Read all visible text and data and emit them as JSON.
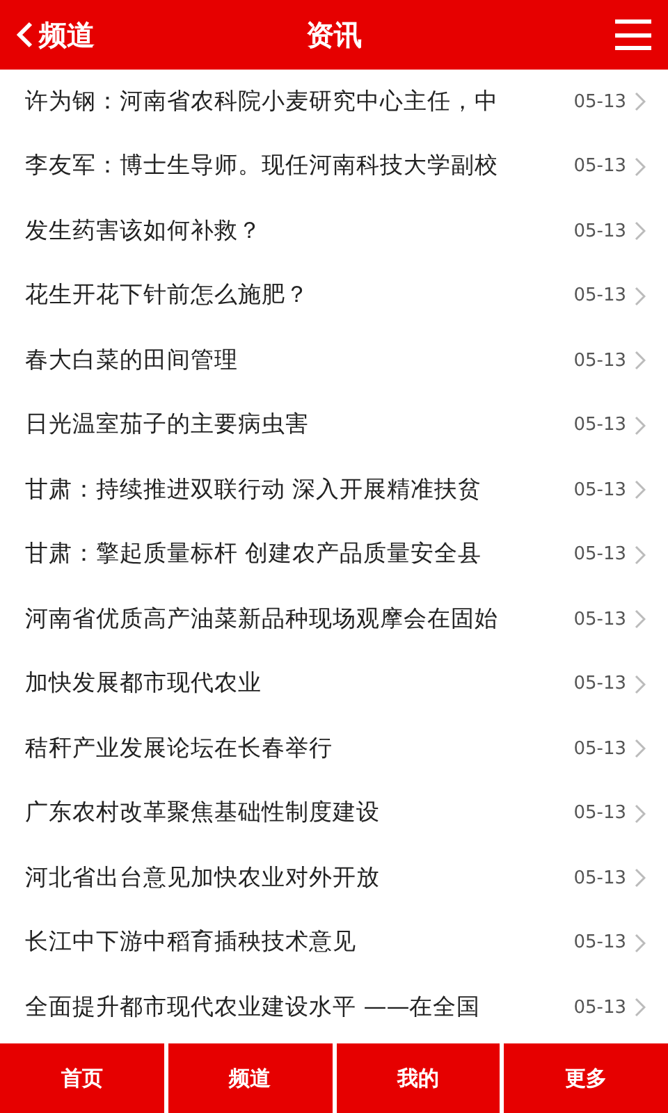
{
  "header": {
    "back_label": "频道",
    "title": "资讯"
  },
  "articles": [
    {
      "title": "许为钢：河南省农科院小麦研究中心主任，中",
      "date": "05-13"
    },
    {
      "title": "李友军：博士生导师。现任河南科技大学副校",
      "date": "05-13"
    },
    {
      "title": "发生药害该如何补救？",
      "date": "05-13"
    },
    {
      "title": "花生开花下针前怎么施肥？",
      "date": "05-13"
    },
    {
      "title": "春大白菜的田间管理",
      "date": "05-13"
    },
    {
      "title": "日光温室茄子的主要病虫害",
      "date": "05-13"
    },
    {
      "title": "甘肃：持续推进双联行动 深入开展精准扶贫",
      "date": "05-13"
    },
    {
      "title": "甘肃：擎起质量标杆 创建农产品质量安全县",
      "date": "05-13"
    },
    {
      "title": "河南省优质高产油菜新品种现场观摩会在固始",
      "date": "05-13"
    },
    {
      "title": "加快发展都市现代农业",
      "date": "05-13"
    },
    {
      "title": "秸秆产业发展论坛在长春举行",
      "date": "05-13"
    },
    {
      "title": "广东农村改革聚焦基础性制度建设",
      "date": "05-13"
    },
    {
      "title": "河北省出台意见加快农业对外开放",
      "date": "05-13"
    },
    {
      "title": "长江中下游中稻育插秧技术意见",
      "date": "05-13"
    },
    {
      "title": "全面提升都市现代农业建设水平 ——在全国",
      "date": "05-13"
    }
  ],
  "tabs": [
    {
      "label": "首页"
    },
    {
      "label": "频道"
    },
    {
      "label": "我的"
    },
    {
      "label": "更多"
    }
  ]
}
